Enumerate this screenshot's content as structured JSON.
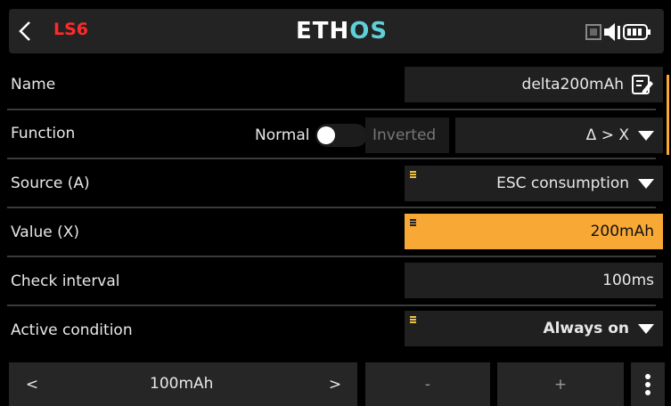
{
  "header": {
    "screen_name": "LS6",
    "logo_main": "ETH",
    "logo_accent": "OS",
    "colors": {
      "screen_name": "#ff2a2a",
      "logo_accent": "#5fd0d8",
      "accent": "#f7a835"
    },
    "icons": [
      "chevron-left-icon",
      "backlight-icon",
      "speaker-icon",
      "battery-icon"
    ]
  },
  "rows": {
    "name": {
      "label": "Name",
      "value": "delta200mAh"
    },
    "function": {
      "label": "Function",
      "toggle_left": "Normal",
      "toggle_right": "Inverted",
      "value": "Δ > X"
    },
    "source": {
      "label": "Source (A)",
      "value": "ESC consumption"
    },
    "value": {
      "label": "Value (X)",
      "value": "200mAh"
    },
    "check_interval": {
      "label": "Check interval",
      "value": "100ms"
    },
    "active_condition": {
      "label": "Active condition",
      "value": "Always on"
    }
  },
  "bottom": {
    "prev": "<",
    "step_value": "100mAh",
    "next": ">",
    "minus": "-",
    "plus": "+"
  }
}
